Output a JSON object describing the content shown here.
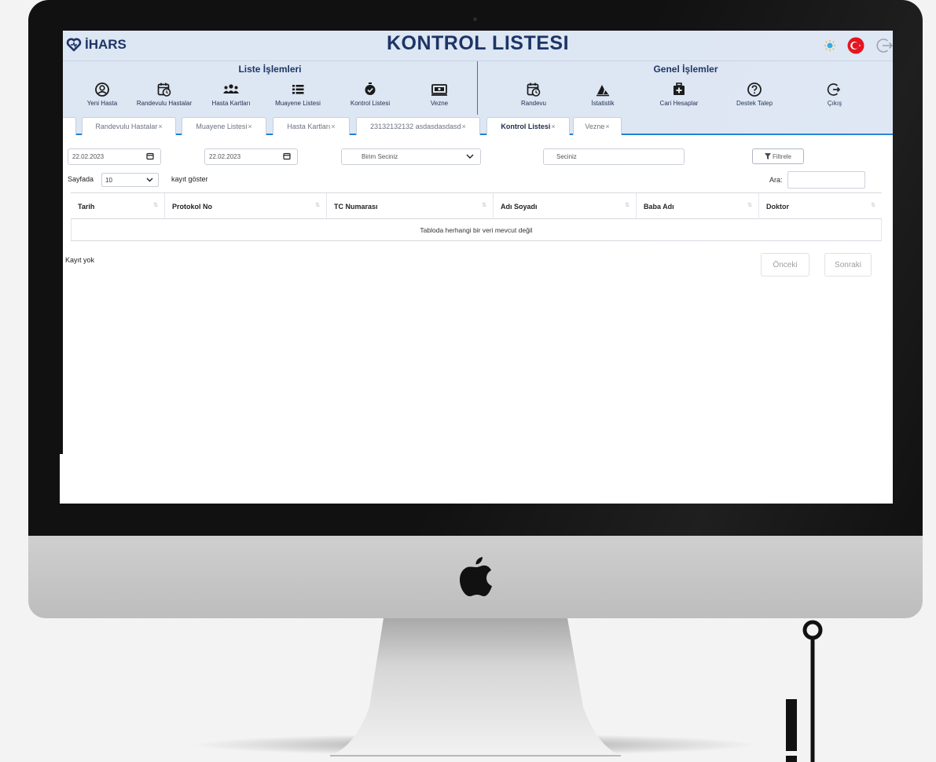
{
  "app": {
    "brand": "İHARS",
    "title": "KONTROL LISTESI"
  },
  "ribbon": {
    "left_group_title": "Liste İşlemleri",
    "right_group_title": "Genel İşlemler",
    "left_buttons": [
      {
        "label": "Yeni Hasta",
        "icon": "user-circle-icon"
      },
      {
        "label": "Randevulu Hastalar",
        "icon": "calendar-clock-icon"
      },
      {
        "label": "Hasta Kartları",
        "icon": "users-icon"
      },
      {
        "label": "Muayene Listesi",
        "icon": "list-icon"
      },
      {
        "label": "Kontrol Listesi",
        "icon": "stopwatch-check-icon"
      },
      {
        "label": "Vezne",
        "icon": "cash-register-icon"
      }
    ],
    "right_buttons": [
      {
        "label": "Randevu",
        "icon": "calendar-clock-icon"
      },
      {
        "label": "İstatistik",
        "icon": "chart-icon"
      },
      {
        "label": "Cari Hesaplar",
        "icon": "briefcase-medical-icon"
      },
      {
        "label": "Destek Talep",
        "icon": "question-circle-icon"
      },
      {
        "label": "Çıkış",
        "icon": "logout-icon"
      }
    ]
  },
  "tabs": [
    {
      "label": "Randevulu Hastalar",
      "close": "×"
    },
    {
      "label": "Muayene Listesi",
      "close": "×"
    },
    {
      "label": "Hasta Kartları",
      "close": "×"
    },
    {
      "label": "23132132132 asdasdasdasd",
      "close": "×"
    },
    {
      "label": "Kontrol Listesi",
      "close": "×"
    },
    {
      "label": "Vezne",
      "close": "×"
    }
  ],
  "filters": {
    "start_date": "22.02.2023",
    "end_date": "22.02.2023",
    "unit_select": "Birim Seciniz",
    "selection_placeholder": "Seciniz",
    "filter_button": "Filtrele"
  },
  "paging": {
    "prefix": "Sayfada",
    "page_size": "10",
    "suffix": "kayıt göster",
    "search_label": "Ara:"
  },
  "table": {
    "columns": [
      "Tarih",
      "Protokol No",
      "TC Numarası",
      "Adı Soyadı",
      "Baba Adı",
      "Doktor"
    ],
    "sort_glyph": "⇅",
    "empty_message": "Tabloda herhangi bir veri mevcut değil"
  },
  "footer": {
    "info": "Kayıt yok",
    "prev": "Önceki",
    "next": "Sonraki"
  },
  "colors": {
    "navy": "#1d3566",
    "header_bg": "#dde6f3",
    "accent_blue": "#1e7fd6"
  }
}
